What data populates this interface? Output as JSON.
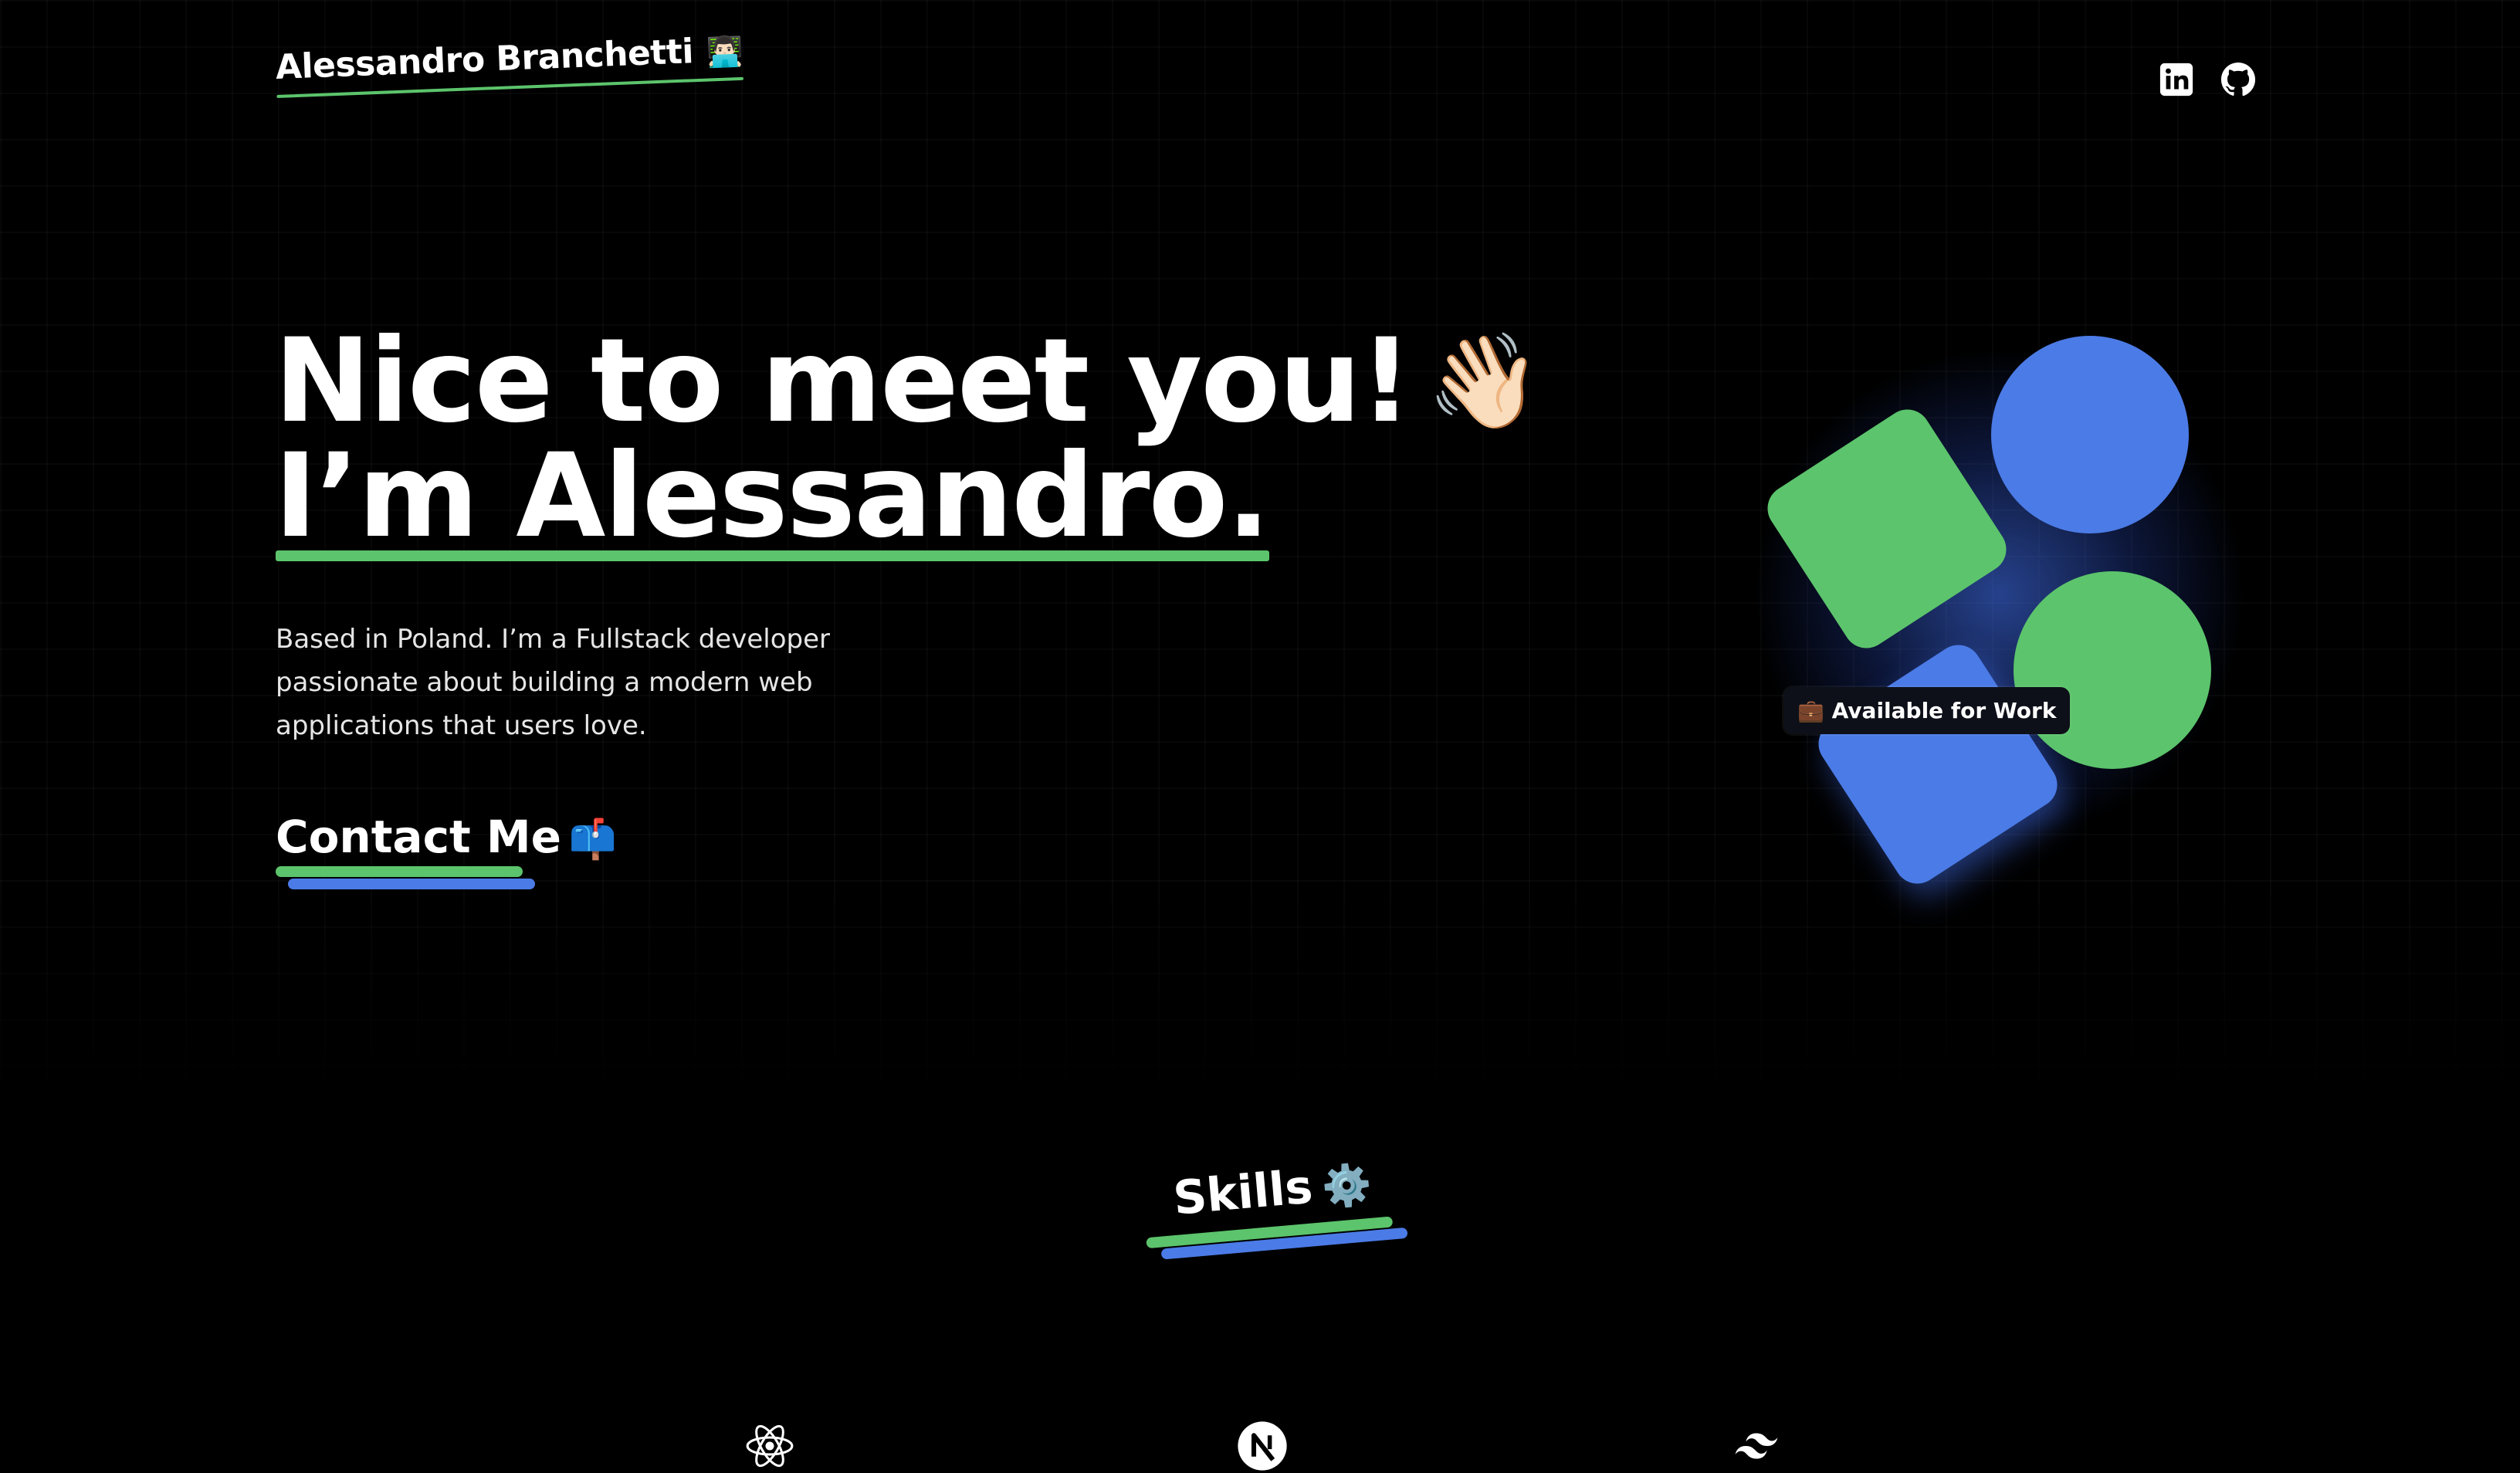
{
  "header": {
    "brand": "Alessandro Branchetti",
    "brand_emoji": "👨🏻‍💻",
    "socials": [
      {
        "name": "linkedin-icon"
      },
      {
        "name": "github-icon"
      }
    ]
  },
  "hero": {
    "line1": "Nice to meet you!",
    "wave_emoji": "👋🏻",
    "line2": "I’m Alessandro.",
    "bio": "Based in Poland. I’m a Fullstack developer passionate about building a modern web applications that users love.",
    "contact_label": "Contact Me",
    "contact_emoji": "📫"
  },
  "art": {
    "badge_emoji": "💼",
    "badge_label": "Available for Work"
  },
  "skills": {
    "title": "Skills",
    "emoji": "⚙️",
    "icons": [
      "react-icon",
      "nextjs-icon",
      "tailwind-icon"
    ]
  },
  "colors": {
    "background": "#000000",
    "green": "#5cc46c",
    "blue": "#4b7be6"
  }
}
